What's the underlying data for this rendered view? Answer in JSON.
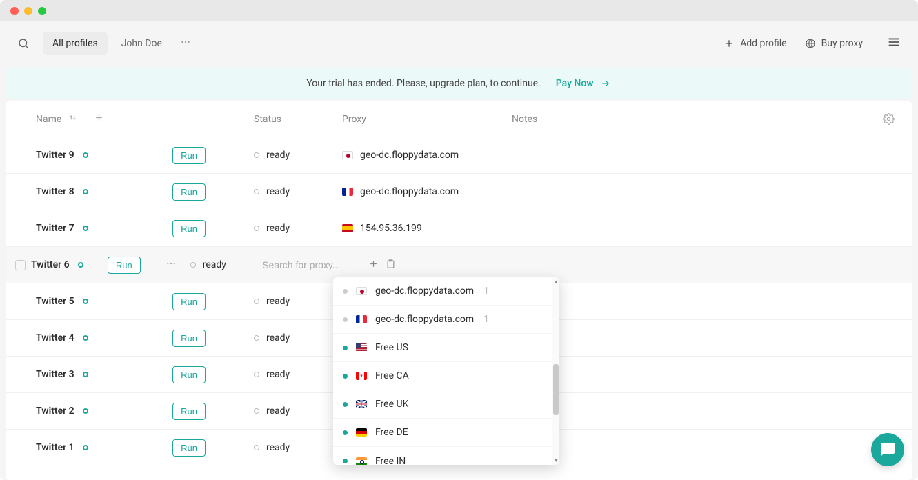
{
  "topbar": {
    "tab_all": "All profiles",
    "tab_user": "John Doe",
    "add_profile": "Add profile",
    "buy_proxy": "Buy proxy"
  },
  "banner": {
    "text": "Your trial has ended. Please, upgrade plan, to continue.",
    "cta": "Pay Now"
  },
  "columns": {
    "name": "Name",
    "status": "Status",
    "proxy": "Proxy",
    "notes": "Notes"
  },
  "run_label": "Run",
  "status_ready": "ready",
  "search_placeholder": "Search for proxy...",
  "rows": [
    {
      "name": "Twitter 9",
      "status": "ready",
      "proxy_flag": "jp",
      "proxy": "geo-dc.floppydata.com"
    },
    {
      "name": "Twitter 8",
      "status": "ready",
      "proxy_flag": "fr",
      "proxy": "geo-dc.floppydata.com"
    },
    {
      "name": "Twitter 7",
      "status": "ready",
      "proxy_flag": "es",
      "proxy": "154.95.36.199"
    },
    {
      "name": "Twitter 6",
      "status": "ready",
      "proxy_flag": "",
      "proxy": ""
    },
    {
      "name": "Twitter 5",
      "status": "ready",
      "proxy_flag": "",
      "proxy": ""
    },
    {
      "name": "Twitter 4",
      "status": "ready",
      "proxy_flag": "",
      "proxy": ""
    },
    {
      "name": "Twitter 3",
      "status": "ready",
      "proxy_flag": "",
      "proxy": ""
    },
    {
      "name": "Twitter 2",
      "status": "ready",
      "proxy_flag": "",
      "proxy": ""
    },
    {
      "name": "Twitter 1",
      "status": "ready",
      "proxy_flag": "",
      "proxy": ""
    }
  ],
  "dropdown": [
    {
      "status": "gray",
      "flag": "jp",
      "label": "geo-dc.floppydata.com",
      "count": "1"
    },
    {
      "status": "gray",
      "flag": "fr",
      "label": "geo-dc.floppydata.com",
      "count": "1"
    },
    {
      "status": "green",
      "flag": "us",
      "label": "Free US",
      "count": ""
    },
    {
      "status": "green",
      "flag": "ca",
      "label": "Free CA",
      "count": ""
    },
    {
      "status": "green",
      "flag": "uk",
      "label": "Free UK",
      "count": ""
    },
    {
      "status": "green",
      "flag": "de",
      "label": "Free DE",
      "count": ""
    },
    {
      "status": "green",
      "flag": "in",
      "label": "Free IN",
      "count": ""
    }
  ]
}
